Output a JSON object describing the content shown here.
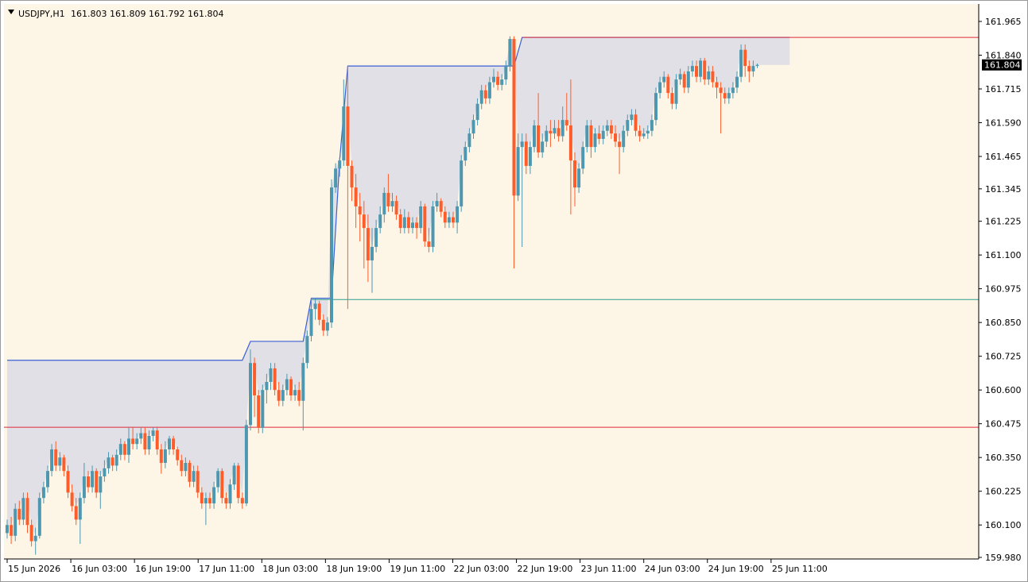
{
  "header": {
    "symbol": "USDJPY,H1",
    "ohlc": "161.803 161.809 161.792 161.804"
  },
  "colors": {
    "background": "#fdf5e6",
    "bull": "#4d97b0",
    "bear": "#fe5c2b",
    "upper_line": "#3b5fd6",
    "fill": "#e0e0e6",
    "red_level": "#e02a3a",
    "teal_level": "#2e9e8e",
    "price_tag": "#000000"
  },
  "chart_data": {
    "type": "candlestick",
    "title": "USDJPY,H1",
    "ylim": [
      159.98,
      161.965
    ],
    "y_ticks": [
      "161.965",
      "161.840",
      "161.715",
      "161.590",
      "161.465",
      "161.345",
      "161.225",
      "161.100",
      "160.975",
      "160.850",
      "160.725",
      "160.600",
      "160.475",
      "160.350",
      "160.225",
      "160.100",
      "159.980"
    ],
    "x_labels": [
      "15 Jun 2026",
      "16 Jun 03:00",
      "16 Jun 19:00",
      "17 Jun 11:00",
      "18 Jun 03:00",
      "18 Jun 19:00",
      "19 Jun 11:00",
      "22 Jun 03:00",
      "22 Jun 19:00",
      "23 Jun 11:00",
      "24 Jun 03:00",
      "24 Jun 19:00",
      "25 Jun 11:00"
    ],
    "current_price": "161.804",
    "levels": [
      {
        "name": "red-lower",
        "value": 160.462
      },
      {
        "name": "teal",
        "value": 160.935
      },
      {
        "name": "red-upper",
        "value": 161.906
      }
    ],
    "upper_band": [
      {
        "bar": 0,
        "value": 160.71
      },
      {
        "bar": 58,
        "value": 160.71
      },
      {
        "bar": 60,
        "value": 160.78
      },
      {
        "bar": 73,
        "value": 160.78
      },
      {
        "bar": 75,
        "value": 160.94
      },
      {
        "bar": 80,
        "value": 160.94
      },
      {
        "bar": 82,
        "value": 161.45
      },
      {
        "bar": 84,
        "value": 161.8
      },
      {
        "bar": 125,
        "value": 161.8
      },
      {
        "bar": 127,
        "value": 161.906
      },
      {
        "bar": 193,
        "value": 161.906
      }
    ],
    "band_fill_end_bar": 193,
    "candles": [
      [
        160.07,
        160.1,
        160.05,
        160.12
      ],
      [
        160.1,
        160.06,
        160.03,
        160.13
      ],
      [
        160.06,
        160.16,
        160.04,
        160.18
      ],
      [
        160.16,
        160.12,
        160.1,
        160.19
      ],
      [
        160.12,
        160.2,
        160.1,
        160.22
      ],
      [
        160.2,
        160.1,
        160.07,
        160.22
      ],
      [
        160.1,
        160.04,
        160.02,
        160.12
      ],
      [
        160.04,
        160.06,
        159.99,
        160.09
      ],
      [
        160.06,
        160.2,
        160.05,
        160.22
      ],
      [
        160.2,
        160.24,
        160.18,
        160.26
      ],
      [
        160.24,
        160.3,
        160.22,
        160.32
      ],
      [
        160.3,
        160.38,
        160.28,
        160.4
      ],
      [
        160.38,
        160.32,
        160.3,
        160.41
      ],
      [
        160.32,
        160.35,
        160.3,
        160.37
      ],
      [
        160.35,
        160.3,
        160.28,
        160.36
      ],
      [
        160.3,
        160.22,
        160.2,
        160.32
      ],
      [
        160.22,
        160.17,
        160.15,
        160.25
      ],
      [
        160.17,
        160.12,
        160.1,
        160.2
      ],
      [
        160.12,
        160.2,
        160.03,
        160.22
      ],
      [
        160.2,
        160.28,
        160.18,
        160.33
      ],
      [
        160.28,
        160.24,
        160.22,
        160.3
      ],
      [
        160.24,
        160.3,
        160.22,
        160.32
      ],
      [
        160.3,
        160.22,
        160.2,
        160.31
      ],
      [
        160.22,
        160.28,
        160.16,
        160.3
      ],
      [
        160.28,
        160.31,
        160.26,
        160.34
      ],
      [
        160.31,
        160.35,
        160.29,
        160.37
      ],
      [
        160.35,
        160.32,
        160.3,
        160.36
      ],
      [
        160.32,
        160.36,
        160.3,
        160.38
      ],
      [
        160.36,
        160.4,
        160.34,
        160.42
      ],
      [
        160.4,
        160.36,
        160.34,
        160.41
      ],
      [
        160.36,
        160.42,
        160.33,
        160.46
      ],
      [
        160.42,
        160.4,
        160.38,
        160.46
      ],
      [
        160.4,
        160.42,
        160.38,
        160.44
      ],
      [
        160.42,
        160.44,
        160.4,
        160.46
      ],
      [
        160.44,
        160.38,
        160.36,
        160.46
      ],
      [
        160.38,
        160.43,
        160.36,
        160.45
      ],
      [
        160.43,
        160.45,
        160.41,
        160.46
      ],
      [
        160.45,
        160.38,
        160.36,
        160.46
      ],
      [
        160.38,
        160.33,
        160.29,
        160.4
      ],
      [
        160.33,
        160.38,
        160.31,
        160.41
      ],
      [
        160.38,
        160.42,
        160.36,
        160.43
      ],
      [
        160.42,
        160.38,
        160.36,
        160.43
      ],
      [
        160.38,
        160.34,
        160.32,
        160.39
      ],
      [
        160.34,
        160.3,
        160.28,
        160.36
      ],
      [
        160.3,
        160.33,
        160.28,
        160.35
      ],
      [
        160.33,
        160.26,
        160.24,
        160.34
      ],
      [
        160.26,
        160.3,
        160.24,
        160.32
      ],
      [
        160.3,
        160.22,
        160.2,
        160.32
      ],
      [
        160.22,
        160.18,
        160.16,
        160.24
      ],
      [
        160.18,
        160.2,
        160.1,
        160.22
      ],
      [
        160.2,
        160.18,
        160.16,
        160.22
      ],
      [
        160.18,
        160.24,
        160.16,
        160.26
      ],
      [
        160.24,
        160.3,
        160.22,
        160.31
      ],
      [
        160.3,
        160.2,
        160.18,
        160.31
      ],
      [
        160.2,
        160.18,
        160.16,
        160.22
      ],
      [
        160.18,
        160.25,
        160.16,
        160.27
      ],
      [
        160.25,
        160.32,
        160.23,
        160.33
      ],
      [
        160.32,
        160.2,
        160.18,
        160.33
      ],
      [
        160.2,
        160.18,
        160.16,
        160.22
      ],
      [
        160.18,
        160.47,
        160.17,
        160.49
      ],
      [
        160.47,
        160.7,
        160.45,
        160.75
      ],
      [
        160.7,
        160.58,
        160.5,
        160.72
      ],
      [
        160.58,
        160.46,
        160.44,
        160.6
      ],
      [
        160.46,
        160.6,
        160.44,
        160.62
      ],
      [
        160.6,
        160.63,
        160.55,
        160.66
      ],
      [
        160.63,
        160.68,
        160.6,
        160.7
      ],
      [
        160.68,
        160.6,
        160.58,
        160.7
      ],
      [
        160.6,
        160.56,
        160.54,
        160.63
      ],
      [
        160.56,
        160.6,
        160.54,
        160.62
      ],
      [
        160.6,
        160.64,
        160.58,
        160.66
      ],
      [
        160.64,
        160.58,
        160.56,
        160.65
      ],
      [
        160.58,
        160.6,
        160.56,
        160.62
      ],
      [
        160.6,
        160.56,
        160.54,
        160.63
      ],
      [
        160.56,
        160.7,
        160.45,
        160.72
      ],
      [
        160.7,
        160.8,
        160.68,
        160.82
      ],
      [
        160.8,
        160.9,
        160.78,
        160.94
      ],
      [
        160.9,
        160.92,
        160.86,
        160.94
      ],
      [
        160.92,
        160.86,
        160.84,
        160.93
      ],
      [
        160.86,
        160.82,
        160.8,
        160.88
      ],
      [
        160.82,
        160.85,
        160.8,
        160.87
      ],
      [
        160.85,
        161.35,
        160.83,
        161.38
      ],
      [
        161.35,
        161.42,
        161.33,
        161.44
      ],
      [
        161.42,
        161.45,
        161.39,
        161.46
      ],
      [
        161.45,
        161.65,
        161.43,
        161.75
      ],
      [
        161.65,
        161.43,
        160.9,
        161.8
      ],
      [
        161.43,
        161.35,
        161.3,
        161.45
      ],
      [
        161.35,
        161.28,
        161.2,
        161.4
      ],
      [
        161.28,
        161.25,
        161.15,
        161.33
      ],
      [
        161.25,
        161.2,
        161.05,
        161.3
      ],
      [
        161.2,
        161.08,
        161.0,
        161.25
      ],
      [
        161.08,
        161.13,
        160.96,
        161.2
      ],
      [
        161.13,
        161.2,
        161.11,
        161.23
      ],
      [
        161.2,
        161.25,
        161.18,
        161.28
      ],
      [
        161.25,
        161.33,
        161.22,
        161.35
      ],
      [
        161.33,
        161.28,
        161.26,
        161.4
      ],
      [
        161.28,
        161.3,
        161.26,
        161.33
      ],
      [
        161.3,
        161.25,
        161.23,
        161.32
      ],
      [
        161.25,
        161.2,
        161.18,
        161.27
      ],
      [
        161.2,
        161.24,
        161.18,
        161.27
      ],
      [
        161.24,
        161.2,
        161.18,
        161.26
      ],
      [
        161.2,
        161.22,
        161.18,
        161.24
      ],
      [
        161.22,
        161.2,
        161.16,
        161.24
      ],
      [
        161.2,
        161.28,
        161.18,
        161.3
      ],
      [
        161.28,
        161.15,
        161.13,
        161.29
      ],
      [
        161.15,
        161.13,
        161.11,
        161.2
      ],
      [
        161.13,
        161.28,
        161.11,
        161.3
      ],
      [
        161.28,
        161.3,
        161.26,
        161.33
      ],
      [
        161.3,
        161.26,
        161.24,
        161.31
      ],
      [
        161.26,
        161.22,
        161.2,
        161.28
      ],
      [
        161.22,
        161.24,
        161.2,
        161.26
      ],
      [
        161.24,
        161.22,
        161.2,
        161.26
      ],
      [
        161.22,
        161.28,
        161.18,
        161.3
      ],
      [
        161.28,
        161.45,
        161.26,
        161.47
      ],
      [
        161.45,
        161.5,
        161.43,
        161.52
      ],
      [
        161.5,
        161.55,
        161.48,
        161.57
      ],
      [
        161.55,
        161.6,
        161.53,
        161.62
      ],
      [
        161.6,
        161.66,
        161.58,
        161.68
      ],
      [
        161.66,
        161.71,
        161.64,
        161.73
      ],
      [
        161.71,
        161.68,
        161.66,
        161.73
      ],
      [
        161.68,
        161.74,
        161.66,
        161.76
      ],
      [
        161.74,
        161.76,
        161.72,
        161.79
      ],
      [
        161.76,
        161.73,
        161.71,
        161.78
      ],
      [
        161.73,
        161.75,
        161.71,
        161.77
      ],
      [
        161.75,
        161.8,
        161.73,
        161.82
      ],
      [
        161.8,
        161.9,
        161.78,
        161.91
      ],
      [
        161.9,
        161.32,
        161.05,
        161.91
      ],
      [
        161.32,
        161.5,
        161.3,
        161.55
      ],
      [
        161.5,
        161.52,
        161.13,
        161.55
      ],
      [
        161.52,
        161.43,
        161.4,
        161.55
      ],
      [
        161.43,
        161.5,
        161.4,
        161.52
      ],
      [
        161.5,
        161.58,
        161.48,
        161.6
      ],
      [
        161.58,
        161.48,
        161.46,
        161.7
      ],
      [
        161.48,
        161.52,
        161.46,
        161.55
      ],
      [
        161.52,
        161.56,
        161.5,
        161.58
      ],
      [
        161.56,
        161.55,
        161.5,
        161.6
      ],
      [
        161.55,
        161.57,
        161.53,
        161.6
      ],
      [
        161.57,
        161.54,
        161.52,
        161.6
      ],
      [
        161.54,
        161.6,
        161.52,
        161.65
      ],
      [
        161.6,
        161.58,
        161.56,
        161.7
      ],
      [
        161.58,
        161.45,
        161.25,
        161.75
      ],
      [
        161.45,
        161.35,
        161.28,
        161.48
      ],
      [
        161.35,
        161.42,
        161.33,
        161.44
      ],
      [
        161.42,
        161.5,
        161.4,
        161.52
      ],
      [
        161.5,
        161.58,
        161.48,
        161.6
      ],
      [
        161.58,
        161.5,
        161.46,
        161.6
      ],
      [
        161.5,
        161.55,
        161.48,
        161.57
      ],
      [
        161.55,
        161.53,
        161.51,
        161.58
      ],
      [
        161.53,
        161.56,
        161.51,
        161.58
      ],
      [
        161.56,
        161.58,
        161.54,
        161.6
      ],
      [
        161.58,
        161.55,
        161.53,
        161.6
      ],
      [
        161.55,
        161.52,
        161.5,
        161.58
      ],
      [
        161.52,
        161.5,
        161.4,
        161.55
      ],
      [
        161.5,
        161.56,
        161.48,
        161.58
      ],
      [
        161.56,
        161.6,
        161.54,
        161.62
      ],
      [
        161.6,
        161.62,
        161.58,
        161.64
      ],
      [
        161.62,
        161.56,
        161.54,
        161.64
      ],
      [
        161.56,
        161.54,
        161.52,
        161.58
      ],
      [
        161.54,
        161.55,
        161.53,
        161.57
      ],
      [
        161.55,
        161.56,
        161.53,
        161.58
      ],
      [
        161.56,
        161.6,
        161.54,
        161.62
      ],
      [
        161.6,
        161.7,
        161.58,
        161.72
      ],
      [
        161.7,
        161.74,
        161.68,
        161.76
      ],
      [
        161.74,
        161.76,
        161.72,
        161.78
      ],
      [
        161.76,
        161.7,
        161.68,
        161.77
      ],
      [
        161.7,
        161.66,
        161.64,
        161.72
      ],
      [
        161.66,
        161.75,
        161.64,
        161.77
      ],
      [
        161.75,
        161.77,
        161.73,
        161.79
      ],
      [
        161.77,
        161.72,
        161.7,
        161.78
      ],
      [
        161.72,
        161.78,
        161.7,
        161.8
      ],
      [
        161.78,
        161.8,
        161.76,
        161.82
      ],
      [
        161.8,
        161.76,
        161.74,
        161.82
      ],
      [
        161.76,
        161.82,
        161.74,
        161.83
      ],
      [
        161.82,
        161.75,
        161.73,
        161.83
      ],
      [
        161.75,
        161.78,
        161.73,
        161.8
      ],
      [
        161.78,
        161.74,
        161.72,
        161.8
      ],
      [
        161.74,
        161.72,
        161.68,
        161.76
      ],
      [
        161.72,
        161.7,
        161.55,
        161.74
      ],
      [
        161.7,
        161.68,
        161.66,
        161.72
      ],
      [
        161.68,
        161.7,
        161.66,
        161.72
      ],
      [
        161.7,
        161.72,
        161.68,
        161.74
      ],
      [
        161.72,
        161.76,
        161.7,
        161.78
      ],
      [
        161.76,
        161.86,
        161.74,
        161.88
      ],
      [
        161.86,
        161.8,
        161.76,
        161.88
      ],
      [
        161.8,
        161.78,
        161.74,
        161.82
      ],
      [
        161.78,
        161.8,
        161.76,
        161.82
      ],
      [
        161.8,
        161.804,
        161.792,
        161.809
      ]
    ]
  }
}
